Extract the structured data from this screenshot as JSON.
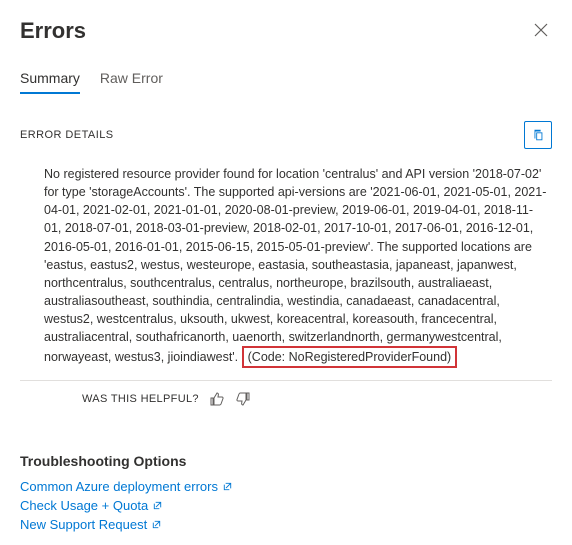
{
  "header": {
    "title": "Errors"
  },
  "tabs": {
    "summary": "Summary",
    "raw_error": "Raw Error"
  },
  "details": {
    "label": "ERROR DETAILS",
    "body_main": "No registered resource provider found for location 'centralus' and API version '2018-07-02' for type 'storageAccounts'. The supported api-versions are '2021-06-01, 2021-05-01, 2021-04-01, 2021-02-01, 2021-01-01, 2020-08-01-preview, 2019-06-01, 2019-04-01, 2018-11-01, 2018-07-01, 2018-03-01-preview, 2018-02-01, 2017-10-01, 2017-06-01, 2016-12-01, 2016-05-01, 2016-01-01, 2015-06-15, 2015-05-01-preview'. The supported locations are 'eastus, eastus2, westus, westeurope, eastasia, southeastasia, japaneast, japanwest, northcentralus, southcentralus, centralus, northeurope, brazilsouth, australiaeast, australiasoutheast, southindia, centralindia, westindia, canadaeast, canadacentral, westus2, westcentralus, uksouth, ukwest, koreacentral, koreasouth, francecentral, australiacentral, southafricanorth, uaenorth, switzerlandnorth, germanywestcentral, norwayeast, westus3, jioindiawest'. ",
    "body_code": "(Code: NoRegisteredProviderFound)",
    "helpful_label": "WAS THIS HELPFUL?"
  },
  "troubleshoot": {
    "heading": "Troubleshooting Options",
    "links": {
      "common_errors": "Common Azure deployment errors",
      "check_usage": "Check Usage + Quota",
      "new_request": "New Support Request"
    }
  }
}
